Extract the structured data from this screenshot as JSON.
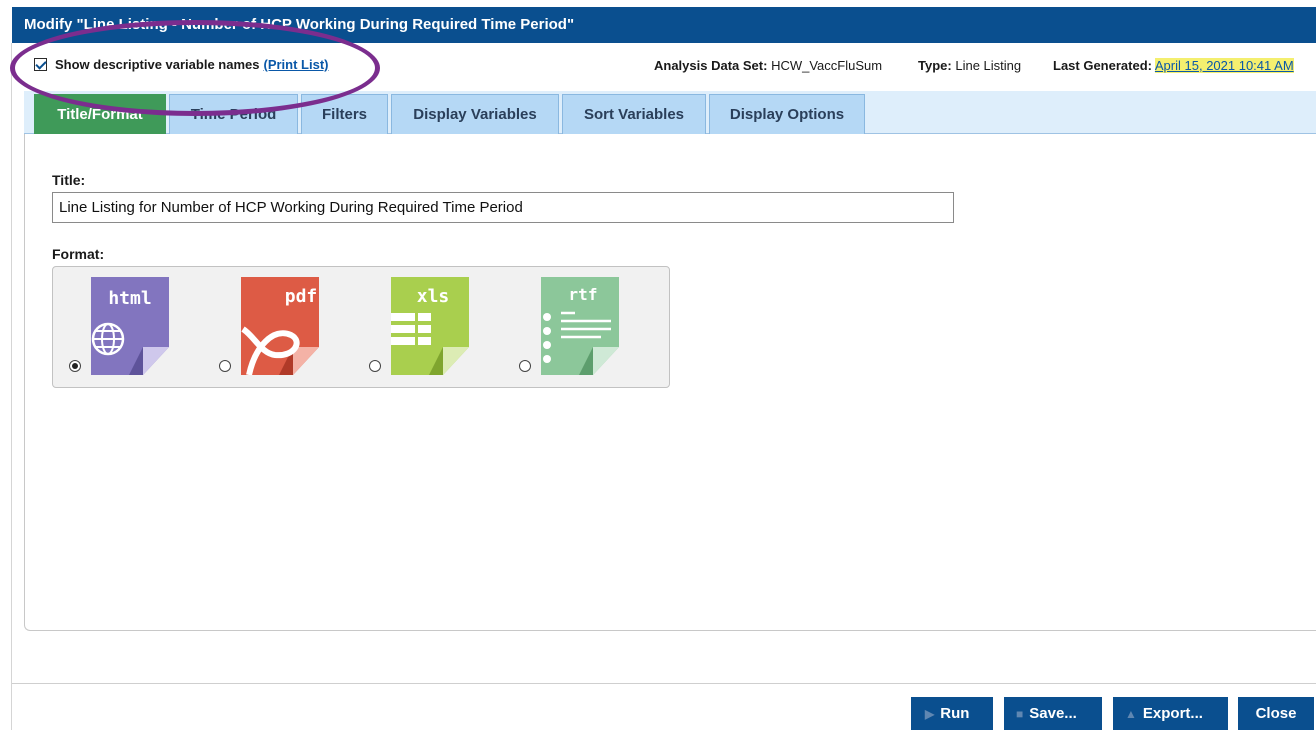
{
  "window": {
    "title": "Modify \"Line Listing - Number of HCP Working During Required Time Period\""
  },
  "infobar": {
    "checkbox_label": "Show descriptive variable names",
    "print_list_link": "(Print List)",
    "analysis_label": "Analysis Data Set:",
    "analysis_value": "HCW_VaccFluSum",
    "type_label": "Type:",
    "type_value": "Line Listing",
    "last_generated_label": "Last Generated:",
    "last_generated_value": "April 15, 2021 10:41 AM"
  },
  "tabs": [
    {
      "label": "Title/Format",
      "active": true
    },
    {
      "label": "Time Period"
    },
    {
      "label": "Filters"
    },
    {
      "label": "Display Variables"
    },
    {
      "label": "Sort Variables"
    },
    {
      "label": "Display Options"
    }
  ],
  "form": {
    "title_label": "Title:",
    "title_value": "Line Listing for Number of HCP Working During Required Time Period",
    "format_label": "Format:",
    "formats": [
      {
        "label": "html",
        "color": "#8275bf",
        "selected": true
      },
      {
        "label": "pdf",
        "color": "#dd5b45",
        "selected": false
      },
      {
        "label": "xls",
        "color": "#a9cf4e",
        "selected": false
      },
      {
        "label": "rtf",
        "color": "#8cc79a",
        "selected": false
      }
    ]
  },
  "buttons": {
    "run": "Run",
    "save": "Save...",
    "export": "Export...",
    "close": "Close"
  },
  "colors": {
    "brand_blue": "#0a4f8f",
    "active_tab": "#3f9a59",
    "inactive_tab": "#b5d8f5",
    "annotation_ellipse": "#7b2d8e",
    "highlight": "#f4ef6f"
  }
}
